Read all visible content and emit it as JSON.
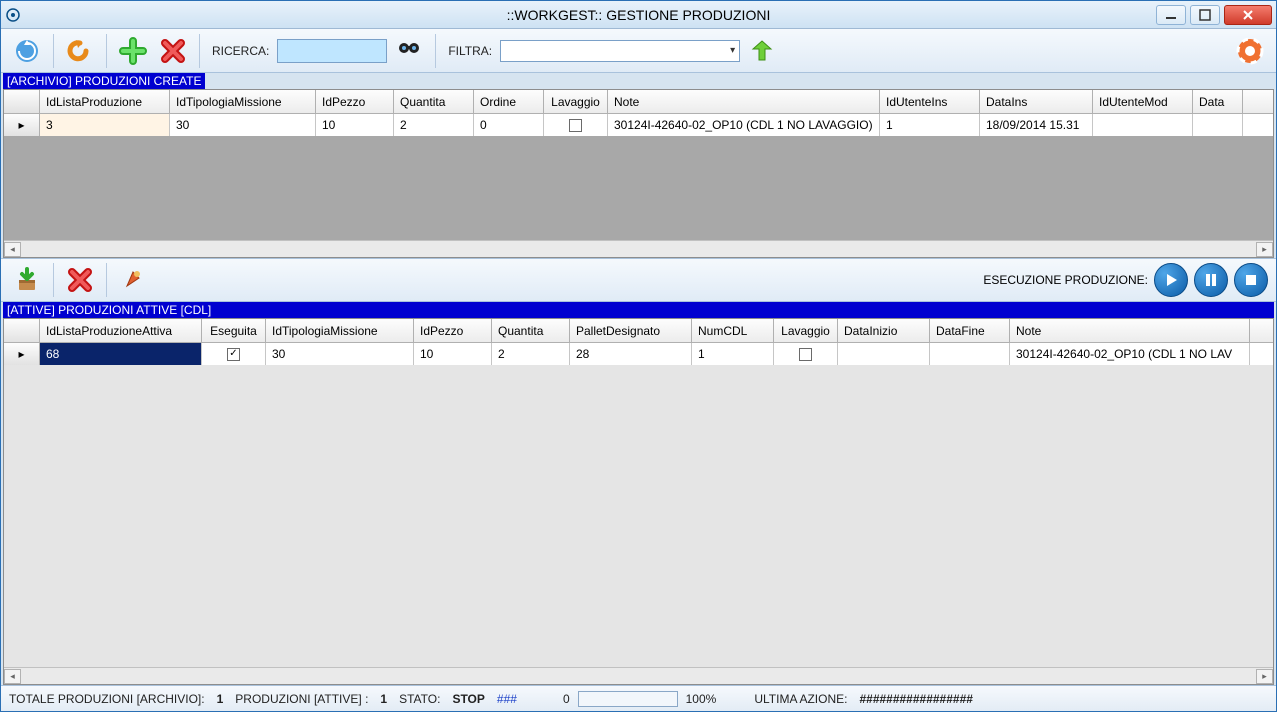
{
  "window": {
    "title": "::WORKGEST::   GESTIONE  PRODUZIONI"
  },
  "toolbar": {
    "search_label": "RICERCA:",
    "search_value": "",
    "filter_label": "FILTRA:",
    "filter_value": ""
  },
  "section1": {
    "title": "[ARCHIVIO] PRODUZIONI CREATE",
    "columns": [
      "IdListaProduzione",
      "IdTipologiaMissione",
      "IdPezzo",
      "Quantita",
      "Ordine",
      "Lavaggio",
      "Note",
      "IdUtenteIns",
      "DataIns",
      "IdUtenteMod",
      "Data"
    ],
    "rows": [
      {
        "IdListaProduzione": "3",
        "IdTipologiaMissione": "30",
        "IdPezzo": "10",
        "Quantita": "2",
        "Ordine": "0",
        "Lavaggio": false,
        "Note": "30124I-42640-02_OP10 (CDL 1 NO LAVAGGIO)",
        "IdUtenteIns": "1",
        "DataIns": "18/09/2014 15.31",
        "IdUtenteMod": "",
        "Data": ""
      }
    ]
  },
  "toolbar2": {
    "exec_label": "ESECUZIONE PRODUZIONE:"
  },
  "section2": {
    "title": "[ATTIVE] PRODUZIONI ATTIVE [CDL]",
    "columns": [
      "IdListaProduzioneAttiva",
      "Eseguita",
      "IdTipologiaMissione",
      "IdPezzo",
      "Quantita",
      "PalletDesignato",
      "NumCDL",
      "Lavaggio",
      "DataInizio",
      "DataFine",
      "Note"
    ],
    "rows": [
      {
        "IdListaProduzioneAttiva": "68",
        "Eseguita": true,
        "IdTipologiaMissione": "30",
        "IdPezzo": "10",
        "Quantita": "2",
        "PalletDesignato": "28",
        "NumCDL": "1",
        "Lavaggio": false,
        "DataInizio": "",
        "DataFine": "",
        "Note": "30124I-42640-02_OP10 (CDL 1 NO LAV"
      }
    ]
  },
  "status": {
    "totale_archivio_label": "TOTALE PRODUZIONI [ARCHIVIO]:",
    "totale_archivio_value": "1",
    "attive_label": "PRODUZIONI [ATTIVE] :",
    "attive_value": "1",
    "stato_label": "STATO:",
    "stato_value": "STOP",
    "hash3": "###",
    "progress_num": "0",
    "progress_pct": "100%",
    "ultima_label": "ULTIMA AZIONE:",
    "ultima_value": "#################"
  }
}
